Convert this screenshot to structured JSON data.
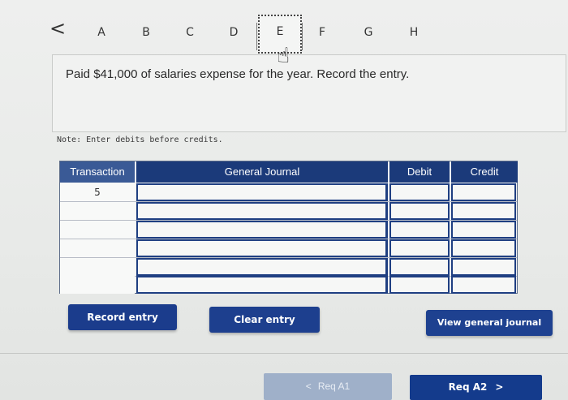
{
  "nav": {
    "back_glyph": "<",
    "tabs": [
      "A",
      "B",
      "C",
      "D",
      "E",
      "F",
      "G",
      "H"
    ],
    "active_tab": "E"
  },
  "question": {
    "text": "Paid $41,000 of salaries expense for the year. Record the entry."
  },
  "note": "Note: Enter debits before credits.",
  "journal": {
    "headers": {
      "transaction": "Transaction",
      "general_journal": "General Journal",
      "debit": "Debit",
      "credit": "Credit"
    },
    "rows": [
      {
        "transaction": "5",
        "account": "",
        "debit": "",
        "credit": ""
      },
      {
        "transaction": "",
        "account": "",
        "debit": "",
        "credit": ""
      },
      {
        "transaction": "",
        "account": "",
        "debit": "",
        "credit": ""
      },
      {
        "transaction": "",
        "account": "",
        "debit": "",
        "credit": ""
      },
      {
        "transaction": "",
        "account": "",
        "debit": "",
        "credit": ""
      },
      {
        "transaction": "",
        "account": "",
        "debit": "",
        "credit": ""
      }
    ]
  },
  "buttons": {
    "record_entry": "Record entry",
    "clear_entry": "Clear entry",
    "view_general_journal": "View general journal"
  },
  "footer": {
    "prev_label": "Req A1",
    "next_label": "Req A2",
    "prev_glyph": "<",
    "next_glyph": ">"
  },
  "colors": {
    "primary_button": "#1b3c8c",
    "header_blue": "#1b3a7a",
    "disabled_button": "#9fb0c9"
  }
}
